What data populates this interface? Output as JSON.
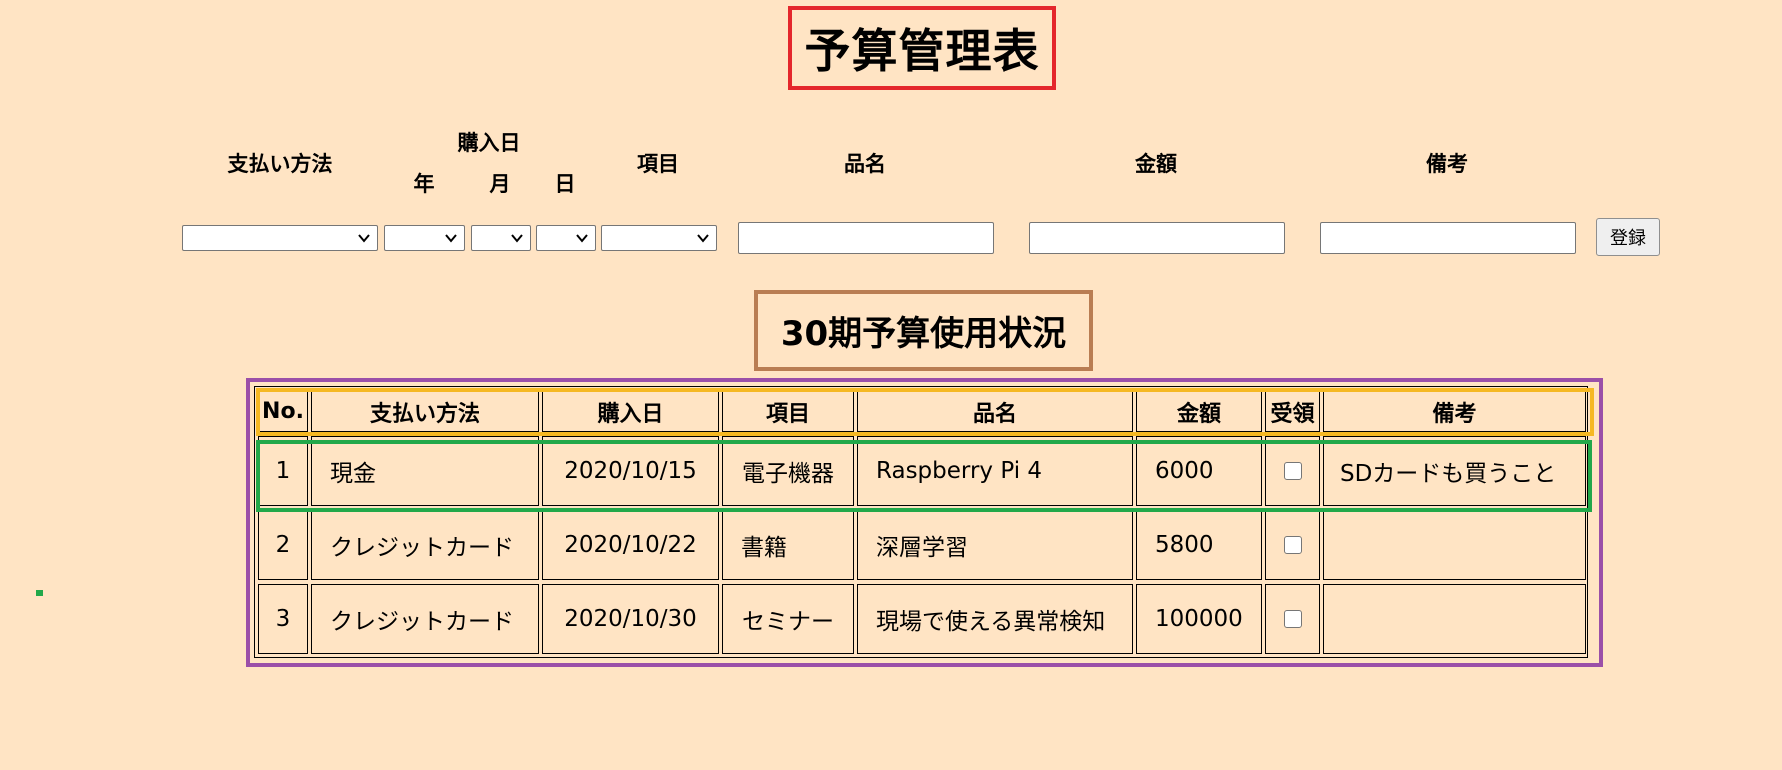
{
  "title": "予算管理表",
  "form": {
    "labels": {
      "payment_method": "支払い方法",
      "purchase_date": "購入日",
      "year": "年",
      "month": "月",
      "day": "日",
      "category": "項目",
      "item_name": "品名",
      "amount": "金額",
      "notes": "備考"
    },
    "inputs": {
      "item_name_value": "",
      "amount_value": "",
      "notes_value": ""
    },
    "register_label": "登録"
  },
  "section_title": "30期予算使用状況",
  "table": {
    "headers": [
      "No.",
      "支払い方法",
      "購入日",
      "項目",
      "品名",
      "金額",
      "受領",
      "備考"
    ],
    "rows": [
      {
        "no": "1",
        "payment": "現金",
        "date": "2020/10/15",
        "category": "電子機器",
        "item": "Raspberry Pi 4",
        "amount": "6000",
        "received": false,
        "notes": "SDカードも買うこと"
      },
      {
        "no": "2",
        "payment": "クレジットカード",
        "date": "2020/10/22",
        "category": "書籍",
        "item": "深層学習",
        "amount": "5800",
        "received": false,
        "notes": ""
      },
      {
        "no": "3",
        "payment": "クレジットカード",
        "date": "2020/10/30",
        "category": "セミナー",
        "item": "現場で使える異常検知",
        "amount": "100000",
        "received": false,
        "notes": ""
      }
    ]
  },
  "colors": {
    "background": "#ffe4c4",
    "title_border": "#e4262b",
    "section_border": "#b97d53",
    "table_frame": "#9b4fa8",
    "header_highlight": "#f5b823",
    "row_highlight": "#22a84a"
  }
}
